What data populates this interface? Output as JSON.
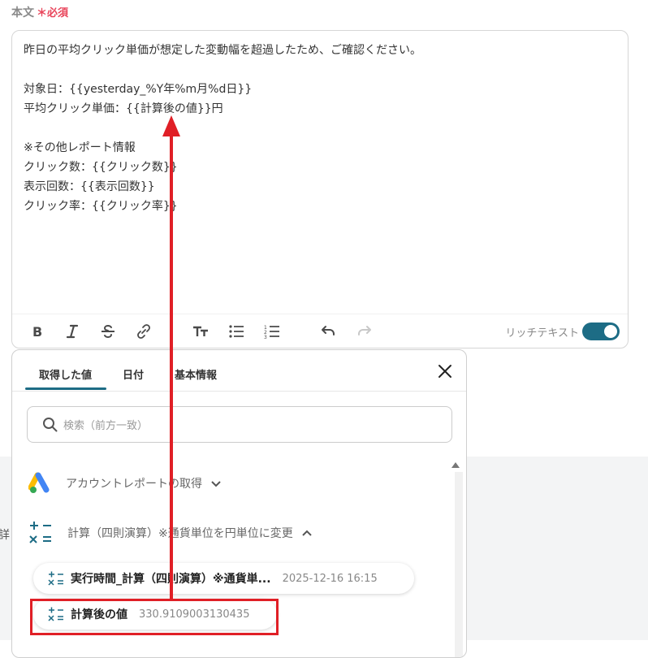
{
  "field": {
    "label": "本文",
    "required_mark": "＊",
    "required_text": "必須"
  },
  "editor": {
    "lines": [
      "昨日の平均クリック単価が想定した変動幅を超過したため、ご確認ください。",
      "",
      "対象日：{{yesterday_%Y年%m月%d日}}",
      "平均クリック単価：{{計算後の値}}円",
      "",
      "※その他レポート情報",
      "クリック数：{{クリック数}}",
      "表示回数：{{表示回数}}",
      "クリック率：{{クリック率}}"
    ]
  },
  "toolbar": {
    "buttons": [
      "bold-icon",
      "italic-icon",
      "strikethrough-icon",
      "link-icon",
      "text-size-icon",
      "bullet-list-icon",
      "numbered-list-icon",
      "undo-icon",
      "redo-icon"
    ],
    "rich_text_label": "リッチテキスト",
    "rich_text_enabled": true,
    "accent_color": "#1d6c85"
  },
  "popup": {
    "tabs": [
      "取得した値",
      "日付",
      "基本情報"
    ],
    "active_tab": 0,
    "search_placeholder": "検索（前方一致）",
    "groups": [
      {
        "label": "アカウントレポートの取得",
        "icon": "google-ads-icon",
        "expanded": false
      },
      {
        "label": "計算（四則演算）※通貨単位を円単位に変更",
        "icon": "calculator-icon",
        "expanded": true
      }
    ],
    "items": [
      {
        "name": "実行時間_計算（四則演算）※通貨単...",
        "value": "2025-12-16 16:15"
      },
      {
        "name": "計算後の値",
        "value": "330.9109003130435"
      }
    ]
  },
  "background": {
    "side_text": "詳"
  },
  "annotation": {
    "color": "#e01f26"
  }
}
